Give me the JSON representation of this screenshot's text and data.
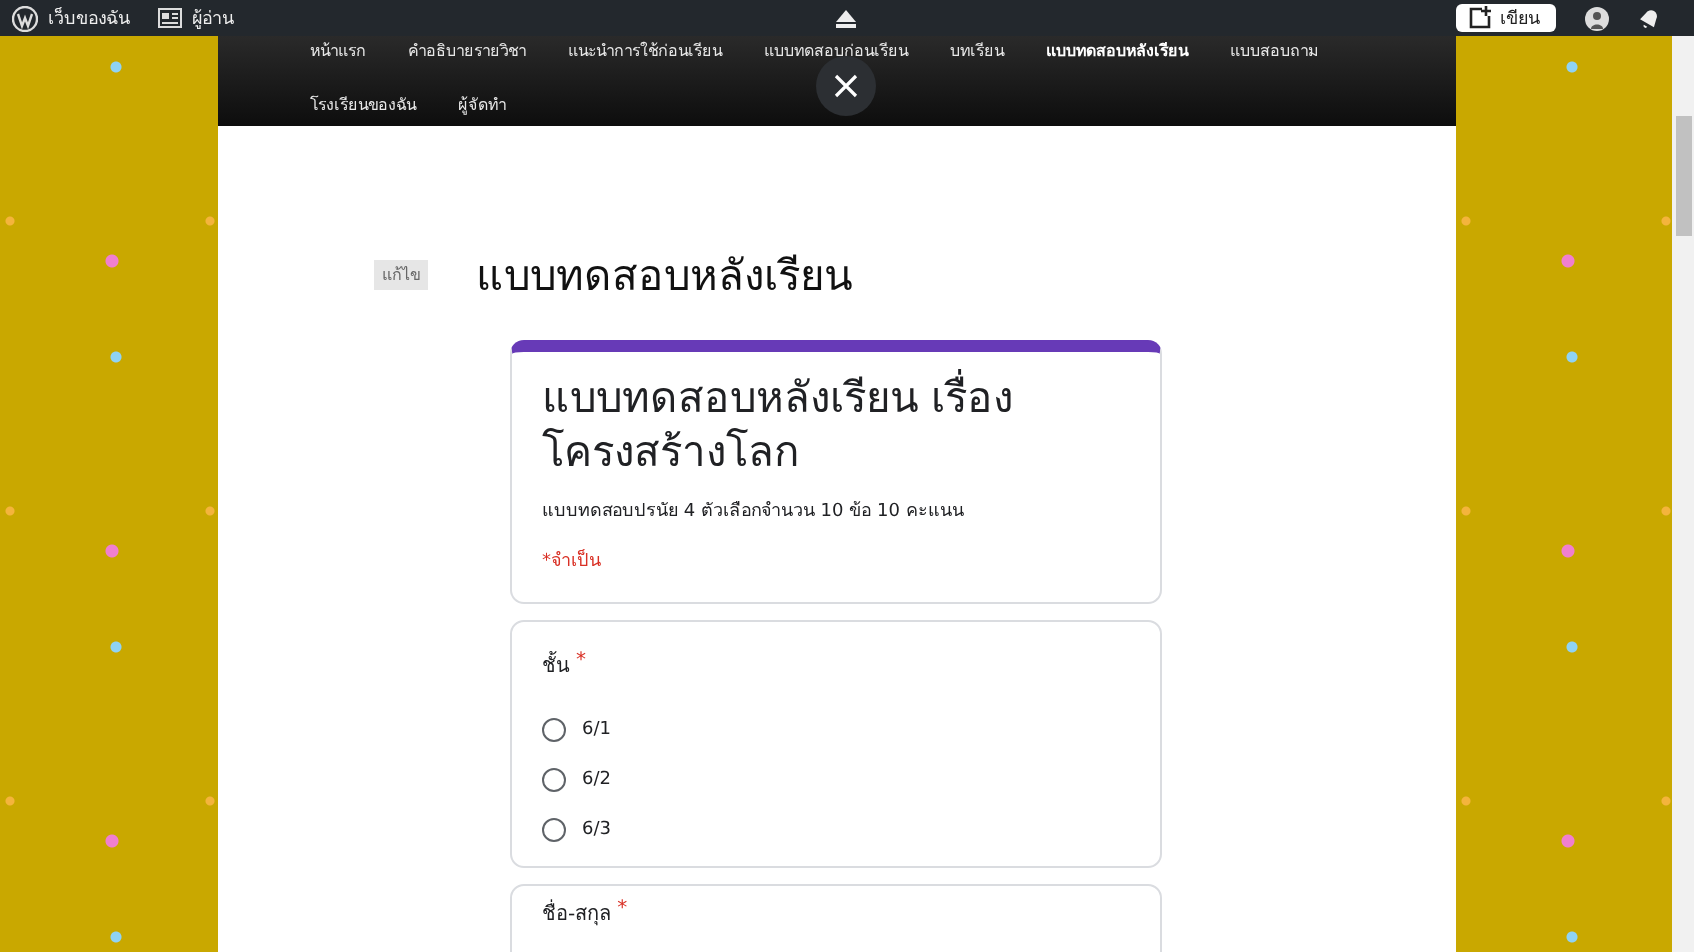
{
  "admin_bar": {
    "site_label": "เว็บของฉัน",
    "reader_label": "ผู้อ่าน",
    "write_button": "เขียน"
  },
  "nav": {
    "items": [
      {
        "label": "หน้าแรก",
        "selected": false
      },
      {
        "label": "คำอธิบายรายวิชา",
        "selected": false
      },
      {
        "label": "แนะนำการใช้ก่อนเรียน",
        "selected": false
      },
      {
        "label": "แบบทดสอบก่อนเรียน",
        "selected": false
      },
      {
        "label": "บทเรียน",
        "selected": false
      },
      {
        "label": "แบบทดสอบหลังเรียน",
        "selected": true
      },
      {
        "label": "แบบสอบถาม",
        "selected": false
      },
      {
        "label": "โรงเรียนของฉัน",
        "selected": false
      },
      {
        "label": "ผู้จัดทำ",
        "selected": false
      }
    ]
  },
  "page": {
    "edit_badge": "แก้ไข",
    "title": "แบบทดสอบหลังเรียน"
  },
  "form": {
    "title": "แบบทดสอบหลังเรียน เรื่อง โครงสร้างโลก",
    "description": "แบบทดสอบปรนัย 4 ตัวเลือกจำนวน 10 ข้อ 10 คะแนน",
    "required_note": "*จำเป็น",
    "questions": [
      {
        "label": "ชั้น",
        "required_mark": "*",
        "options": [
          {
            "label": "6/1",
            "selected": false
          },
          {
            "label": "6/2",
            "selected": false
          },
          {
            "label": "6/3",
            "selected": false
          }
        ]
      },
      {
        "label": "ชื่อ-สกุล",
        "required_mark": "*"
      }
    ]
  }
}
